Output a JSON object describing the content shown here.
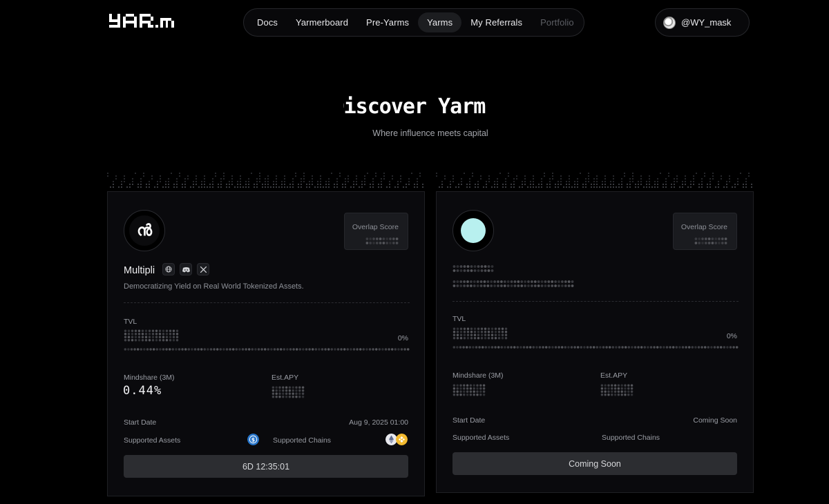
{
  "header": {
    "logo_text": "YAR.m",
    "nav": [
      {
        "label": "Docs",
        "state": "normal"
      },
      {
        "label": "Yarmerboard",
        "state": "normal"
      },
      {
        "label": "Pre-Yarms",
        "state": "normal"
      },
      {
        "label": "Yarms",
        "state": "active"
      },
      {
        "label": "My Referrals",
        "state": "normal"
      },
      {
        "label": "Portfolio",
        "state": "muted"
      }
    ],
    "user": {
      "handle": "@WY_mask"
    }
  },
  "hero": {
    "title": "Discover Yarms",
    "subtitle": "Where influence meets capital"
  },
  "cards": [
    {
      "name": "Multipli",
      "icon": "multipli-logo",
      "description": "Democratizing Yield on Real World Tokenized Assets.",
      "overlap_label": "Overlap Score",
      "socials": [
        "globe-icon",
        "discord-icon",
        "x-icon"
      ],
      "tvl_label": "TVL",
      "tvl_percent": "0%",
      "mindshare_label": "Mindshare (3M)",
      "mindshare_value": "0.44%",
      "apy_label": "Est.APY",
      "start_label": "Start Date",
      "start_value": "Aug 9, 2025 01:00",
      "assets_label": "Supported Assets",
      "chains_label": "Supported Chains",
      "assets": [
        "usdc-icon"
      ],
      "chains": [
        "ethereum-icon",
        "bnb-icon"
      ],
      "cta_label": "6D 12:35:01"
    },
    {
      "name": "",
      "icon": "cyan-circle",
      "overlap_label": "Overlap Score",
      "tvl_label": "TVL",
      "tvl_percent": "0%",
      "mindshare_label": "Mindshare (3M)",
      "apy_label": "Est.APY",
      "start_label": "Start Date",
      "start_value": "Coming Soon",
      "assets_label": "Supported Assets",
      "chains_label": "Supported Chains",
      "cta_label": "Coming Soon"
    }
  ],
  "colors": {
    "background": "#000000",
    "card": "#0a0a0d",
    "accent_cyan": "#b8f0ef",
    "usdc": "#2775ca",
    "bnb": "#f3ba2f"
  }
}
